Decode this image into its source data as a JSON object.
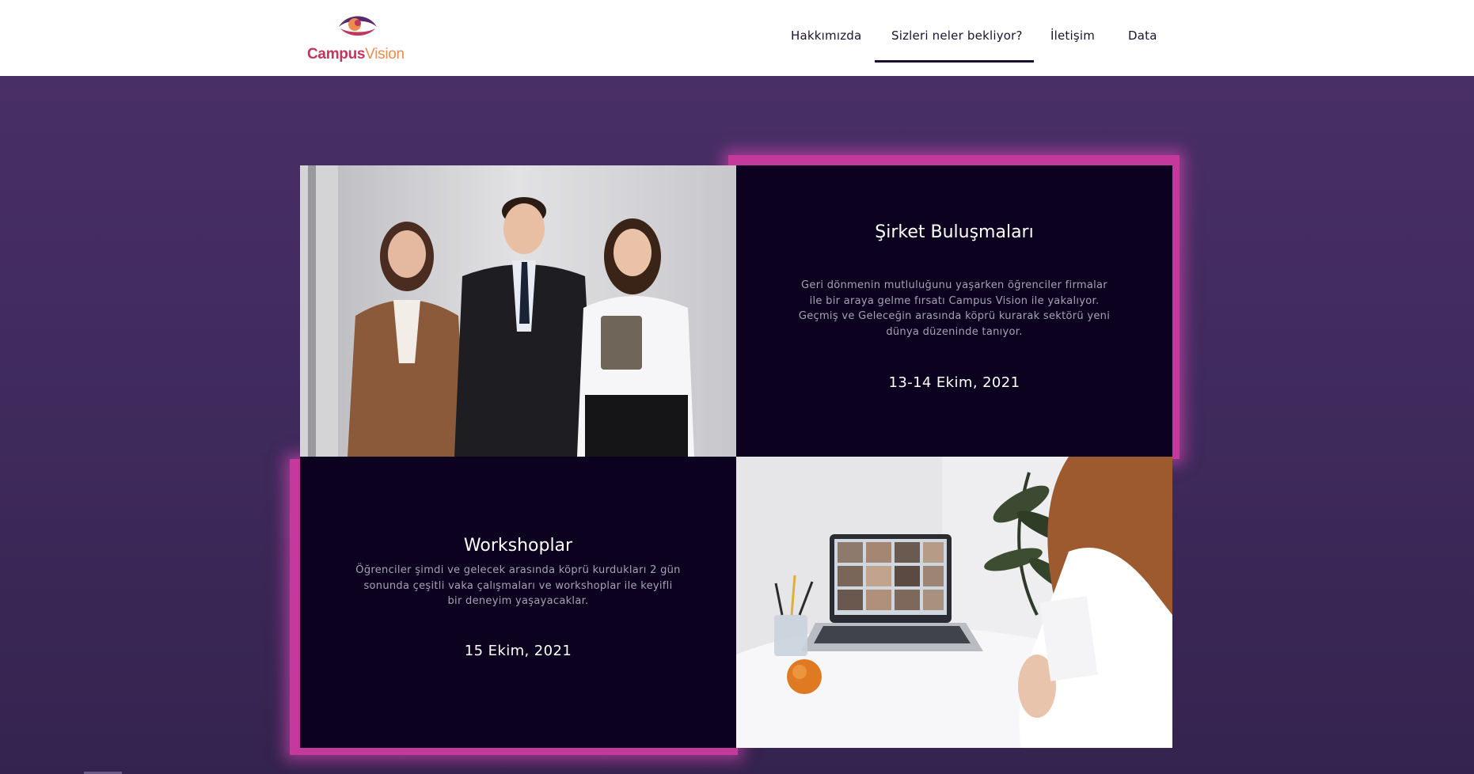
{
  "brand": {
    "name_part1": "Campus",
    "name_part2": "Vision",
    "colors": {
      "magenta": "#c0365e",
      "orange": "#e98d4c",
      "purple": "#5b2a6b"
    }
  },
  "nav": {
    "items": [
      {
        "label": "Hakkımızda"
      },
      {
        "label": "Sizleri neler bekliyor?",
        "active": true
      },
      {
        "label": "İletişim"
      },
      {
        "label": "Data"
      }
    ]
  },
  "events": [
    {
      "title": "Şirket Buluşmaları",
      "description": "Geri dönmenin mutluluğunu yaşarken öğrenciler firmalar ile bir araya gelme fırsatı Campus Vision ile yakalıyor. Geçmiş ve Geleceğin arasında köprü kurarak sektörü yeni dünya düzeninde tanıyor.",
      "date": "13-14 Ekim, 2021",
      "image_icon": "business-team-photo"
    },
    {
      "title": "Workshoplar",
      "description": "Öğrenciler şimdi ve gelecek arasında köprü kurdukları 2 gün sonunda çeşitli vaka çalışmaları ve workshoplar ile keyifli bir deneyim yaşayacaklar.",
      "date": "15 Ekim, 2021",
      "image_icon": "video-call-laptop-photo"
    }
  ],
  "colors": {
    "page_bg": "#4a3068",
    "tile_bg": "#0c0220",
    "glow": "#c3399c",
    "nav_active_underline": "#1a0c33"
  }
}
